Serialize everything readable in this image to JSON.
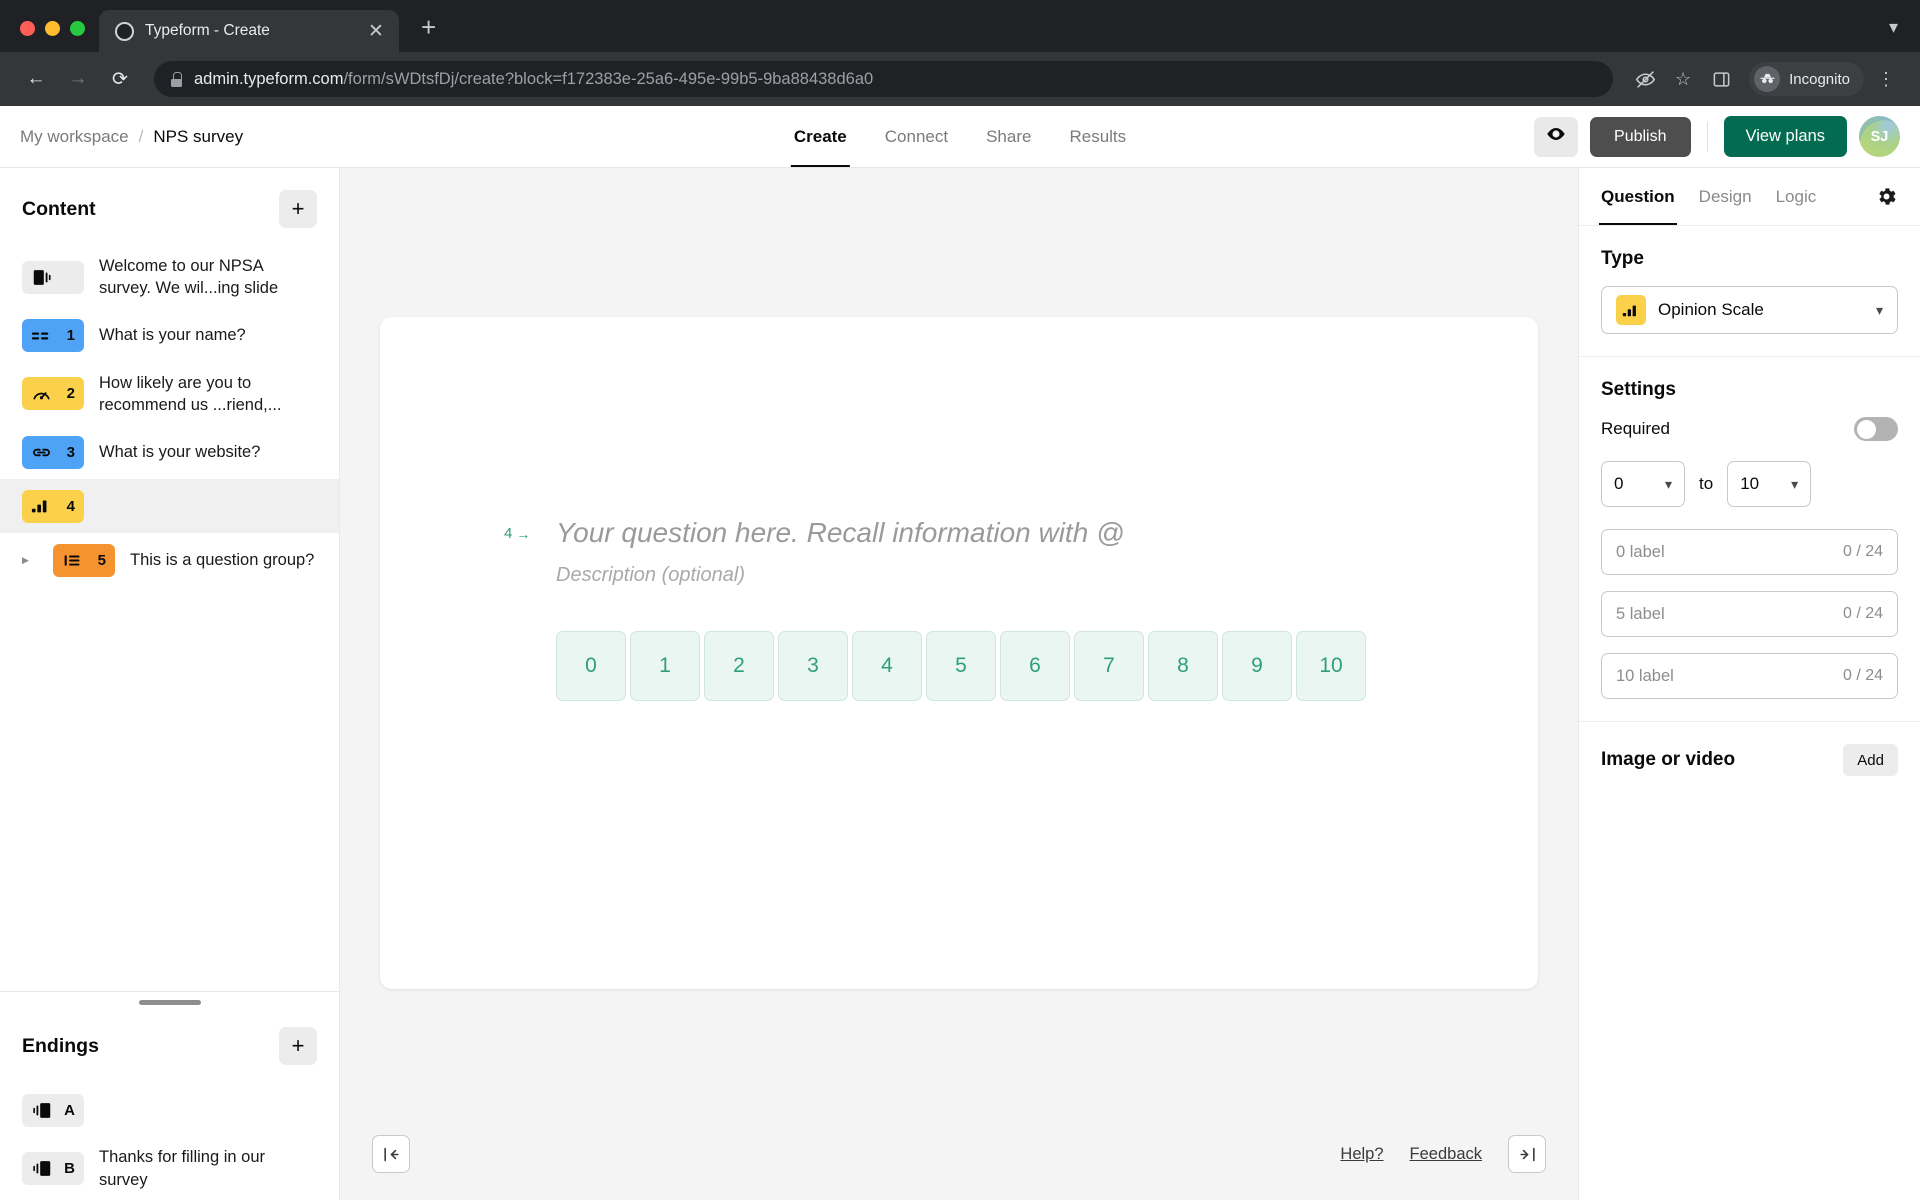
{
  "browser": {
    "tab": {
      "title": "Typeform - Create",
      "favicon_icon": "circle-favicon",
      "close_icon": "close-icon"
    },
    "new_tab_icon": "plus-icon",
    "tabstrip_menu_icon": "chevron-down-icon",
    "back_icon": "arrow-left-icon",
    "forward_icon": "arrow-right-icon",
    "reload_icon": "reload-icon",
    "lock_icon": "lock-icon",
    "url_domain": "admin.typeform.com",
    "url_path": "/form/sWDtsfDj/create?block=f172383e-25a6-495e-99b5-9ba88438d6a0",
    "url_full": "admin.typeform.com/form/sWDtsfDj/create?block=f172383e-25a6-495e-99b5-9ba88438d6a0",
    "tracking_icon": "eye-slash-icon",
    "bookmark_icon": "star-icon",
    "sidepanel_icon": "side-panel-icon",
    "incognito_label": "Incognito",
    "incognito_icon": "incognito-hat-icon",
    "menu_icon": "kebab-menu-icon"
  },
  "appbar": {
    "workspace": "My workspace",
    "separator": "/",
    "form_name": "NPS survey",
    "tabs": [
      {
        "label": "Create",
        "active": true
      },
      {
        "label": "Connect",
        "active": false
      },
      {
        "label": "Share",
        "active": false
      },
      {
        "label": "Results",
        "active": false
      }
    ],
    "preview_icon": "eye-icon",
    "publish_label": "Publish",
    "view_plans_label": "View plans",
    "avatar_initials": "SJ"
  },
  "sidebar": {
    "content": {
      "title": "Content",
      "add_icon": "plus-icon",
      "items": [
        {
          "badge": "",
          "badge_color": "grey",
          "icon": "statement-icon",
          "label": "Welcome to our NPSA survey. We wil...ing slide",
          "selected": false,
          "group": false
        },
        {
          "badge": "1",
          "badge_color": "blue",
          "icon": "short-text-icon",
          "label": "What is your name?",
          "selected": false,
          "group": false
        },
        {
          "badge": "2",
          "badge_color": "yellow",
          "icon": "opinion-gauge-icon",
          "label": "How likely are you to recommend us ...riend,...",
          "selected": false,
          "group": false
        },
        {
          "badge": "3",
          "badge_color": "blue",
          "icon": "link-icon",
          "label": "What is your website?",
          "selected": false,
          "group": false
        },
        {
          "badge": "4",
          "badge_color": "yellow",
          "icon": "opinion-scale-icon",
          "label": "",
          "selected": true,
          "group": false
        },
        {
          "badge": "5",
          "badge_color": "orange",
          "icon": "question-group-icon",
          "label": "This is a question group?",
          "selected": false,
          "group": true
        }
      ]
    },
    "endings": {
      "title": "Endings",
      "add_icon": "plus-icon",
      "drag_handle_icon": "drag-handle-icon",
      "items": [
        {
          "badge": "A",
          "badge_color": "grey",
          "icon": "ending-icon",
          "label": ""
        },
        {
          "badge": "B",
          "badge_color": "grey",
          "icon": "ending-icon",
          "label": "Thanks for filling in our survey"
        }
      ]
    }
  },
  "canvas": {
    "question_index": "4",
    "question_arrow_icon": "arrow-right-icon",
    "question_placeholder": "Your question here. Recall information with @",
    "description_placeholder": "Description (optional)",
    "scale_values": [
      "0",
      "1",
      "2",
      "3",
      "4",
      "5",
      "6",
      "7",
      "8",
      "9",
      "10"
    ],
    "collapse_left_icon": "collapse-left-icon",
    "collapse_right_icon": "collapse-right-icon",
    "help_label": "Help?",
    "feedback_label": "Feedback"
  },
  "right_panel": {
    "tabs": [
      {
        "label": "Question",
        "active": true
      },
      {
        "label": "Design",
        "active": false
      },
      {
        "label": "Logic",
        "active": false
      }
    ],
    "settings_gear_icon": "gear-icon",
    "type_heading": "Type",
    "type_value": "Opinion Scale",
    "type_icon": "opinion-scale-icon",
    "type_chevron_icon": "chevron-down-icon",
    "settings_heading": "Settings",
    "required_label": "Required",
    "required_on": false,
    "range_from": "0",
    "range_to_label": "to",
    "range_to": "10",
    "label_fields": [
      {
        "placeholder": "0 label",
        "counter": "0 / 24"
      },
      {
        "placeholder": "5 label",
        "counter": "0 / 24"
      },
      {
        "placeholder": "10 label",
        "counter": "0 / 24"
      }
    ],
    "media_heading": "Image or video",
    "media_add_label": "Add"
  },
  "colors": {
    "accent_green": "#036b52",
    "scale_green": "#2e9e7e",
    "badge_blue": "#4fa3f7",
    "badge_yellow": "#fbd14b",
    "badge_orange": "#f59331"
  }
}
